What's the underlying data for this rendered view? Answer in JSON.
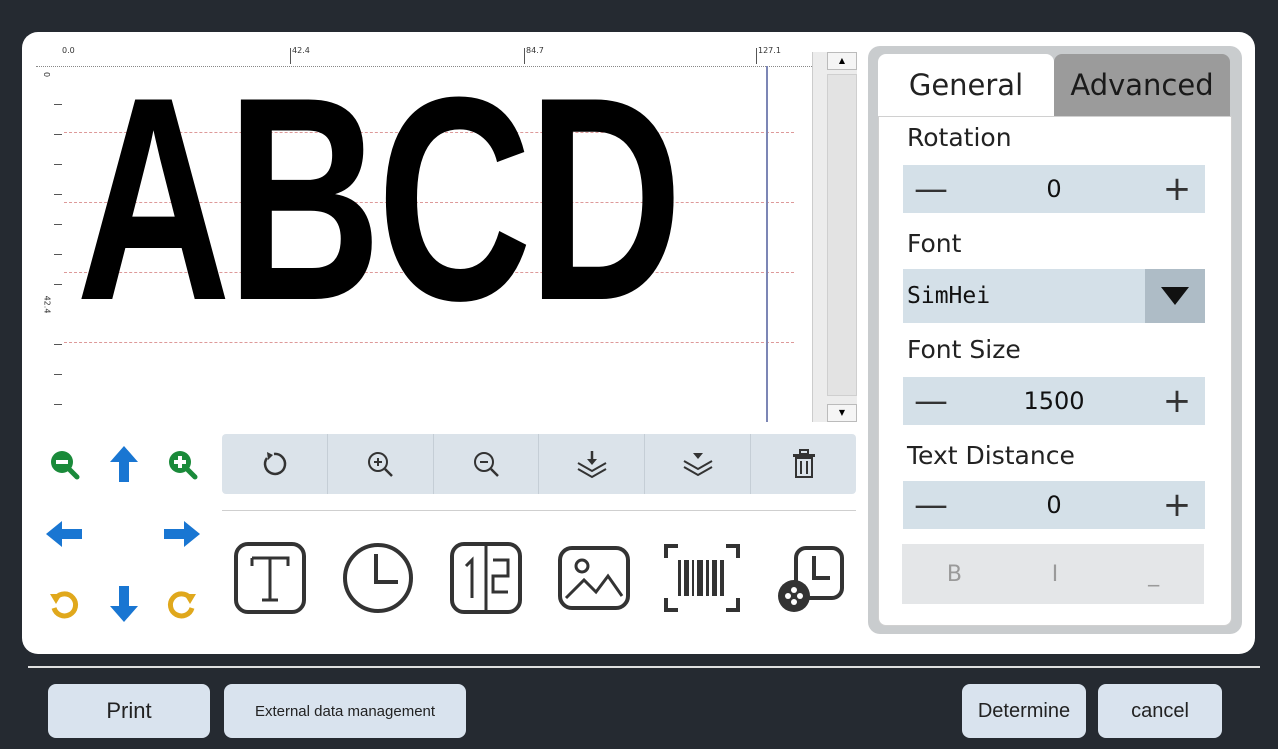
{
  "canvas": {
    "text": "ABCD",
    "ruler_top_labels": [
      "0.0",
      "42.4",
      "84.7",
      "127.1"
    ],
    "ruler_left_labels": [
      "0",
      "42.4"
    ],
    "scroll_up_glyph": "▲",
    "scroll_down_glyph": "▼"
  },
  "nav_controls": [
    {
      "name": "zoom-out-icon",
      "color": "#1a8a3a"
    },
    {
      "name": "move-up-icon",
      "color": "#1976d2"
    },
    {
      "name": "zoom-in-icon",
      "color": "#1a8a3a"
    },
    {
      "name": "move-left-icon",
      "color": "#1976d2"
    },
    {
      "name": "move-right-icon",
      "color": "#1976d2"
    },
    {
      "name": "rotate-left-icon",
      "color": "#e0a81c"
    },
    {
      "name": "move-down-icon",
      "color": "#1976d2"
    },
    {
      "name": "rotate-right-icon",
      "color": "#e0a81c"
    }
  ],
  "toolbar": [
    "rotate-icon",
    "zoom-in-icon",
    "zoom-out-icon",
    "layer-down-icon",
    "layer-up-icon",
    "trash-icon"
  ],
  "insert_tools": [
    "text-icon",
    "clock-icon",
    "serial-number-icon",
    "image-icon",
    "barcode-icon",
    "date-time-icon"
  ],
  "panel": {
    "tab_general": "General",
    "tab_advanced": "Advanced",
    "rotation_label": "Rotation",
    "rotation_value": "0",
    "font_label": "Font",
    "font_value": "SimHei",
    "font_size_label": "Font Size",
    "font_size_value": "1500",
    "text_distance_label": "Text Distance",
    "text_distance_value": "0",
    "minus": "—",
    "plus": "+",
    "bold": "B",
    "italic": "I",
    "underline": "_"
  },
  "buttons": {
    "print": "Print",
    "external": "External data management",
    "determine": "Determine",
    "cancel": "cancel"
  }
}
